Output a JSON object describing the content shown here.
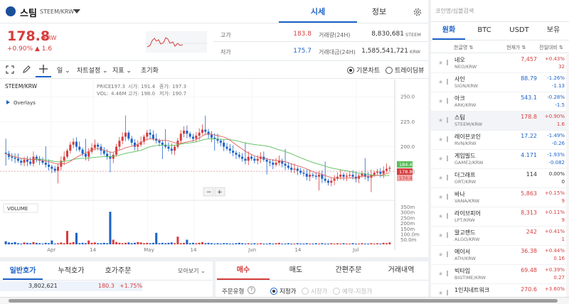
{
  "header": {
    "coin_name": "스팀",
    "pair": "STEEM/KRW",
    "tabs": [
      "시세",
      "정보"
    ]
  },
  "price": {
    "value": "178.8",
    "unit": "KRW",
    "change_pct": "+0.90%",
    "change_abs": "▲ 1.6"
  },
  "stats": {
    "high_label": "고가",
    "high_value": "183.8",
    "low_label": "저가",
    "low_value": "175.7",
    "volume_label": "거래량(24H)",
    "volume_value": "8,830,681",
    "volume_unit": "STEEM",
    "amount_label": "거래대금(24H)",
    "amount_value": "1,585,541,721",
    "amount_unit": "KRW"
  },
  "toolbar": {
    "interval": "일",
    "chart_settings": "차트설정",
    "indicators": "지표",
    "reset": "초기화",
    "basic_chart": "기본차트",
    "tradingview": "트레이딩뷰"
  },
  "chart_info": {
    "symbol": "STEEM/KRW",
    "overlays": "Overlays",
    "price_lbl": "PRICE:",
    "price_val": "197.3",
    "vol_lbl": "VOL:",
    "vol_val": "4.46M",
    "open_lbl": "시가:",
    "open_val": "191.4",
    "high_lbl": "고가:",
    "high_val": "198.0",
    "close_lbl": "종가:",
    "close_val": "197.3",
    "low_lbl": "저가:",
    "low_val": "190.7",
    "volume_title": "VOLUME",
    "price_tag_green": "184.4",
    "price_tag_red": "178.8",
    "price_tag_pink": "174.4"
  },
  "chart_data": {
    "type": "candlestick",
    "y_axis_ticks": [
      "250.0",
      "225.0",
      "200.0",
      "175.0"
    ],
    "volume_axis_ticks": [
      "350m",
      "300m",
      "250m",
      "200m",
      "150m",
      "100.0m",
      "50.0m"
    ],
    "x_axis_ticks": [
      "Apr",
      "14",
      "May",
      "14",
      "Jun",
      "14",
      "Jul"
    ],
    "ylim": [
      150,
      260
    ],
    "closes": [
      193,
      190,
      189,
      188,
      186,
      184,
      187,
      185,
      183,
      190,
      188,
      186,
      184,
      182,
      180,
      178,
      176,
      180,
      186,
      190,
      196,
      202,
      205,
      200,
      197,
      193,
      190,
      195,
      199,
      202,
      200,
      196,
      193,
      190,
      188,
      192,
      200,
      206,
      210,
      214,
      208,
      204,
      200,
      202,
      205,
      210,
      214,
      212,
      208,
      206,
      204,
      202,
      200,
      198,
      196,
      200,
      206,
      213,
      216,
      213,
      210,
      208,
      211,
      214,
      217,
      215,
      212,
      209,
      208,
      206,
      204,
      200,
      198,
      196,
      194,
      192,
      190,
      188,
      186,
      190,
      188,
      186,
      188,
      190,
      187,
      185,
      184,
      182,
      184,
      186,
      183,
      181,
      179,
      177,
      178,
      176,
      174,
      173,
      170,
      172,
      171,
      170,
      172,
      168,
      166,
      164,
      166,
      168,
      170,
      172,
      170,
      171,
      172,
      170,
      168,
      171,
      173,
      170,
      169,
      172,
      174,
      175,
      173,
      176,
      178,
      179
    ],
    "volume_pct": [
      8,
      5,
      4,
      6,
      3,
      2,
      5,
      4,
      3,
      6,
      4,
      3,
      2,
      4,
      3,
      10,
      2,
      3,
      5,
      3,
      35,
      4,
      6,
      30,
      3,
      4,
      3,
      10,
      4,
      5,
      3,
      3,
      4,
      3,
      85,
      12,
      6,
      4,
      3,
      4,
      5,
      3,
      4,
      6,
      5,
      3,
      4,
      3,
      4,
      30,
      3,
      4,
      3,
      4,
      5,
      3,
      20,
      3,
      4,
      12,
      3,
      4,
      3,
      4,
      6,
      3,
      4,
      3,
      2,
      3,
      2,
      3,
      3,
      2,
      2,
      3,
      4,
      3,
      2,
      3,
      2,
      3,
      2,
      3,
      2,
      2,
      3,
      2,
      3,
      4,
      2,
      2,
      3,
      2,
      2,
      3,
      2,
      2,
      3,
      2,
      2,
      3,
      2,
      3,
      2,
      2,
      3,
      2,
      3,
      2,
      3,
      2,
      2,
      3,
      2,
      2,
      3,
      2,
      2,
      3,
      2,
      3,
      2,
      4,
      3,
      5
    ]
  },
  "bottom_left": {
    "tabs": [
      "일반호가",
      "누적호가",
      "호가주문"
    ],
    "view": "모아보기",
    "row_qty": "3,802,621",
    "row_price": "180.3",
    "row_pct": "+1.75%"
  },
  "bottom_right": {
    "tabs": [
      "매수",
      "매도",
      "간편주문",
      "거래내역"
    ],
    "order_type_label": "주문유형",
    "opt_limit": "지정가",
    "opt_market": "시장가",
    "opt_reserve": "예약-지정가"
  },
  "market": {
    "search_placeholder": "코인명/심볼검색",
    "tabs": [
      "원화",
      "BTC",
      "USDT",
      "보유"
    ],
    "col_name": "한글명",
    "col_price": "현재가",
    "col_change": "전일대비",
    "rows": [
      {
        "name": "네오",
        "pair": "NEO/KRW",
        "price": "7,457",
        "pct": "+0.43%",
        "abs": "32",
        "dir": "up"
      },
      {
        "name": "사인",
        "pair": "SIGN/KRW",
        "price": "88.79",
        "pct": "-1.26%",
        "abs": "-1.13",
        "dir": "down"
      },
      {
        "name": "아크",
        "pair": "ARK/KRW",
        "price": "543.1",
        "pct": "-0.28%",
        "abs": "-1.5",
        "dir": "down"
      },
      {
        "name": "스팀",
        "pair": "STEEM/KRW",
        "price": "178.8",
        "pct": "+0.90%",
        "abs": "1.6",
        "dir": "up"
      },
      {
        "name": "레이븐코인",
        "pair": "RVN/KRW",
        "price": "17.22",
        "pct": "-1.49%",
        "abs": "-0.26",
        "dir": "down"
      },
      {
        "name": "게임빌드",
        "pair": "GAME2/KRW",
        "price": "4.171",
        "pct": "-1.93%",
        "abs": "-0.082",
        "dir": "down"
      },
      {
        "name": "더그래프",
        "pair": "GRT/KRW",
        "price": "114",
        "pct": "0.00%",
        "abs": "0",
        "dir": "flat"
      },
      {
        "name": "바나",
        "pair": "VANA/KRW",
        "price": "5,863",
        "pct": "+0.15%",
        "abs": "9",
        "dir": "up"
      },
      {
        "name": "라이브피어",
        "pair": "LPT/KRW",
        "price": "8,313",
        "pct": "+0.11%",
        "abs": "9",
        "dir": "up"
      },
      {
        "name": "알고랜드",
        "pair": "ALGO/KRW",
        "price": "242",
        "pct": "+0.41%",
        "abs": "1",
        "dir": "up"
      },
      {
        "name": "에이서",
        "pair": "ATH/KRW",
        "price": "36.38",
        "pct": "+0.44%",
        "abs": "0.16",
        "dir": "up"
      },
      {
        "name": "빅타임",
        "pair": "BIGTIME/KRW",
        "price": "69.48",
        "pct": "+0.39%",
        "abs": "0.27",
        "dir": "up"
      },
      {
        "name": "1인치네트워크",
        "pair": "",
        "price": "270.6",
        "pct": "+3.60%",
        "abs": "",
        "dir": "up"
      }
    ]
  },
  "colors": {
    "up": "#d63d3d",
    "down": "#1d63c8",
    "accent": "#1d63c8",
    "ma_green": "#5cbf5c",
    "ma_red": "#e0605a"
  }
}
